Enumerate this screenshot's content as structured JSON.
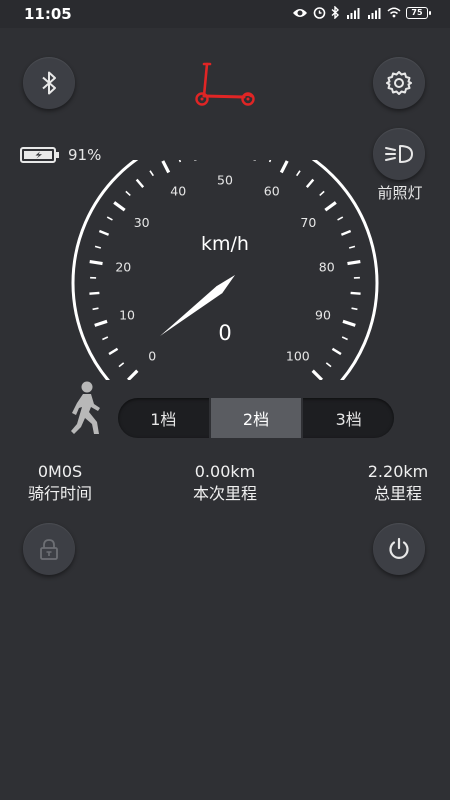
{
  "status_bar": {
    "time": "11:05",
    "battery_level": "75"
  },
  "battery": {
    "percent": "91%"
  },
  "headlight": {
    "label": "前照灯"
  },
  "gauge": {
    "unit": "km/h",
    "speed": "0",
    "speed_value": 0,
    "min": 0,
    "max": 100,
    "scale_labels": [
      "0",
      "10",
      "20",
      "30",
      "40",
      "50",
      "60",
      "70",
      "80",
      "90",
      "100"
    ]
  },
  "gears": [
    {
      "label": "1档",
      "active": false
    },
    {
      "label": "2档",
      "active": true
    },
    {
      "label": "3档",
      "active": false
    }
  ],
  "stats": {
    "ride_time": {
      "value": "0M0S",
      "label": "骑行时间"
    },
    "trip_distance": {
      "value": "0.00km",
      "label": "本次里程"
    },
    "total_distance": {
      "value": "2.20km",
      "label": "总里程"
    }
  },
  "colors": {
    "background": "#2f3034",
    "button": "#3d3f45",
    "scooter": "#e02525",
    "active_gear": "#5a5c61"
  },
  "icons": [
    "bluetooth-icon",
    "scooter-icon",
    "gear-icon",
    "headlight-icon",
    "battery-icon",
    "walker-icon",
    "lock-icon",
    "power-icon"
  ]
}
